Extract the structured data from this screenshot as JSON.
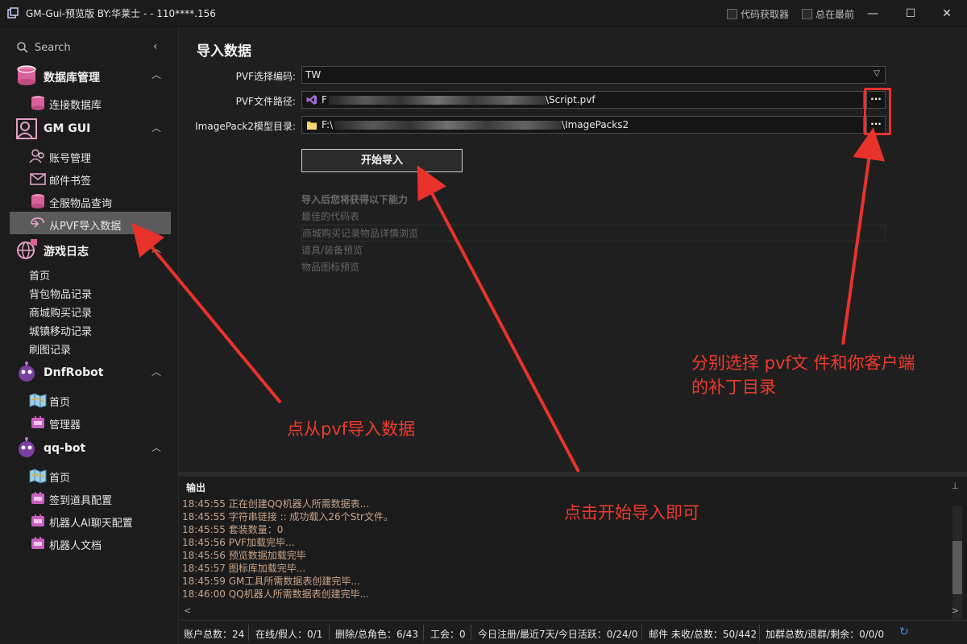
{
  "window": {
    "title": "GM-Gui-预览版 BY:华莱士 -  - 110****.156",
    "checkboxes": [
      {
        "label": "代码获取器",
        "checked": false
      },
      {
        "label": "总在最前",
        "checked": false
      }
    ],
    "controls": {
      "minimize": "—",
      "maximize": "☐",
      "close": "✕"
    }
  },
  "sidebar": {
    "search_label": "Search",
    "collapse_icon": "‹",
    "groups": [
      {
        "label": "数据库管理",
        "icon": "database-icon",
        "items": [
          {
            "label": "连接数据库",
            "icon": "database-icon"
          }
        ]
      },
      {
        "label": "GM GUI",
        "icon": "user-icon",
        "items": [
          {
            "label": "账号管理",
            "icon": "users-icon"
          },
          {
            "label": "邮件书签",
            "icon": "mail-icon"
          },
          {
            "label": "全服物品查询",
            "icon": "database-icon"
          },
          {
            "label": "从PVF导入数据",
            "icon": "import-icon",
            "active": true
          }
        ]
      },
      {
        "label": "游戏日志",
        "icon": "globe-icon",
        "subitems": [
          "首页",
          "背包物品记录",
          "商城购买记录",
          "城镇移动记录",
          "刷图记录"
        ]
      },
      {
        "label": "DnfRobot",
        "icon": "robot-icon",
        "items": [
          {
            "label": "首页",
            "icon": "map-icon"
          },
          {
            "label": "管理器",
            "icon": "badge-icon"
          }
        ]
      },
      {
        "label": "qq-bot",
        "icon": "robot-icon",
        "items": [
          {
            "label": "首页",
            "icon": "map-icon"
          },
          {
            "label": "签到道具配置",
            "icon": "badge-icon"
          },
          {
            "label": "机器人AI聊天配置",
            "icon": "badge-icon"
          },
          {
            "label": "机器人文档",
            "icon": "badge-icon"
          }
        ]
      }
    ]
  },
  "main": {
    "title": "导入数据",
    "encoding_label": "PVF选择编码:",
    "encoding_value": "TW",
    "pvf_label": "PVF文件路径:",
    "pvf_prefix": "F",
    "pvf_suffix": "\\Script.pvf",
    "imagepack_label": "ImagePack2模型目录:",
    "imagepack_prefix": "F:\\",
    "imagepack_suffix": "\\ImagePacks2",
    "browse_label": "···",
    "start_button": "开始导入",
    "features_heading": "导入后您将获得以下能力",
    "features": [
      "最佳的代码表",
      "商城购买记录物品详情浏览",
      "道具/装备预览",
      "物品图标预览"
    ]
  },
  "annotations": {
    "pvf_import": "点从pvf导入数据",
    "start_import": "点击开始导入即可",
    "choose_files_line1": "分别选择 pvf文 件和你客户端",
    "choose_files_line2": "的补丁目录"
  },
  "output": {
    "heading": "输出",
    "pin": "⊥",
    "lines": [
      "18:45:55 正在创建QQ机器人所需数据表...",
      "18:45:55 字符串链接 :: 成功载入26个Str文件。",
      "18:45:55 套装数量：0",
      "18:45:56 PVF加载完毕...",
      "18:45:56 预览数据加载完毕",
      "18:45:57 图标库加载完毕...",
      "18:45:59 GM工具所需数据表创建完毕...",
      "18:46:00 QQ机器人所需数据表创建完毕..."
    ],
    "scroll_left": "<",
    "scroll_right": ">"
  },
  "status": {
    "items": [
      "账户总数：24",
      "在线/假人：0/1",
      "删除/总角色：6/43",
      "工会：0",
      "今日注册/最近7天/今日活跃：0/24/0",
      "邮件 未收/总数：50/442",
      "加群总数/退群/剩余：0/0/0"
    ],
    "refresh_icon": "↻"
  },
  "colors": {
    "accent_red": "#e8322c",
    "refresh_blue": "#3a8fe0",
    "log_text": "#c9a489"
  }
}
